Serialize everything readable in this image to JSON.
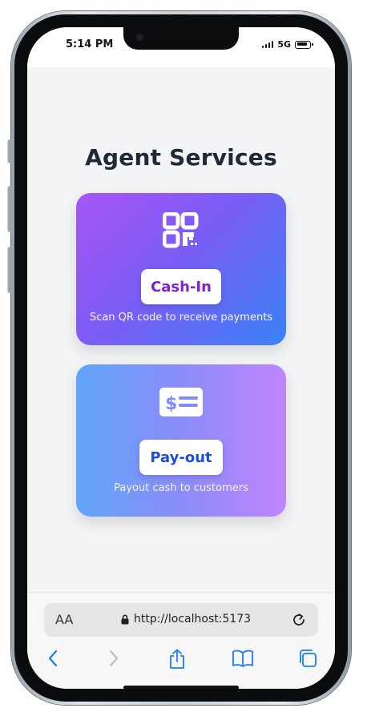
{
  "status_bar": {
    "time": "5:14 PM",
    "network": "5G"
  },
  "page": {
    "title": "Agent Services"
  },
  "cards": [
    {
      "id": "cash-in",
      "button_label": "Cash-In",
      "description": "Scan QR code to receive payments",
      "icon": "qr-code-icon"
    },
    {
      "id": "payout",
      "button_label": "Pay-out",
      "description": "Payout cash to customers",
      "icon": "cash-icon"
    }
  ],
  "browser": {
    "text_size_label": "AA",
    "url": "http://localhost:5173"
  },
  "toolbar": {
    "icons": [
      "back-icon",
      "forward-icon",
      "share-icon",
      "bookmarks-icon",
      "tabs-icon"
    ]
  },
  "colors": {
    "accent_purple": "#7e22ce",
    "accent_blue": "#1d4ed8",
    "browser_blue": "#1a7cf5"
  }
}
